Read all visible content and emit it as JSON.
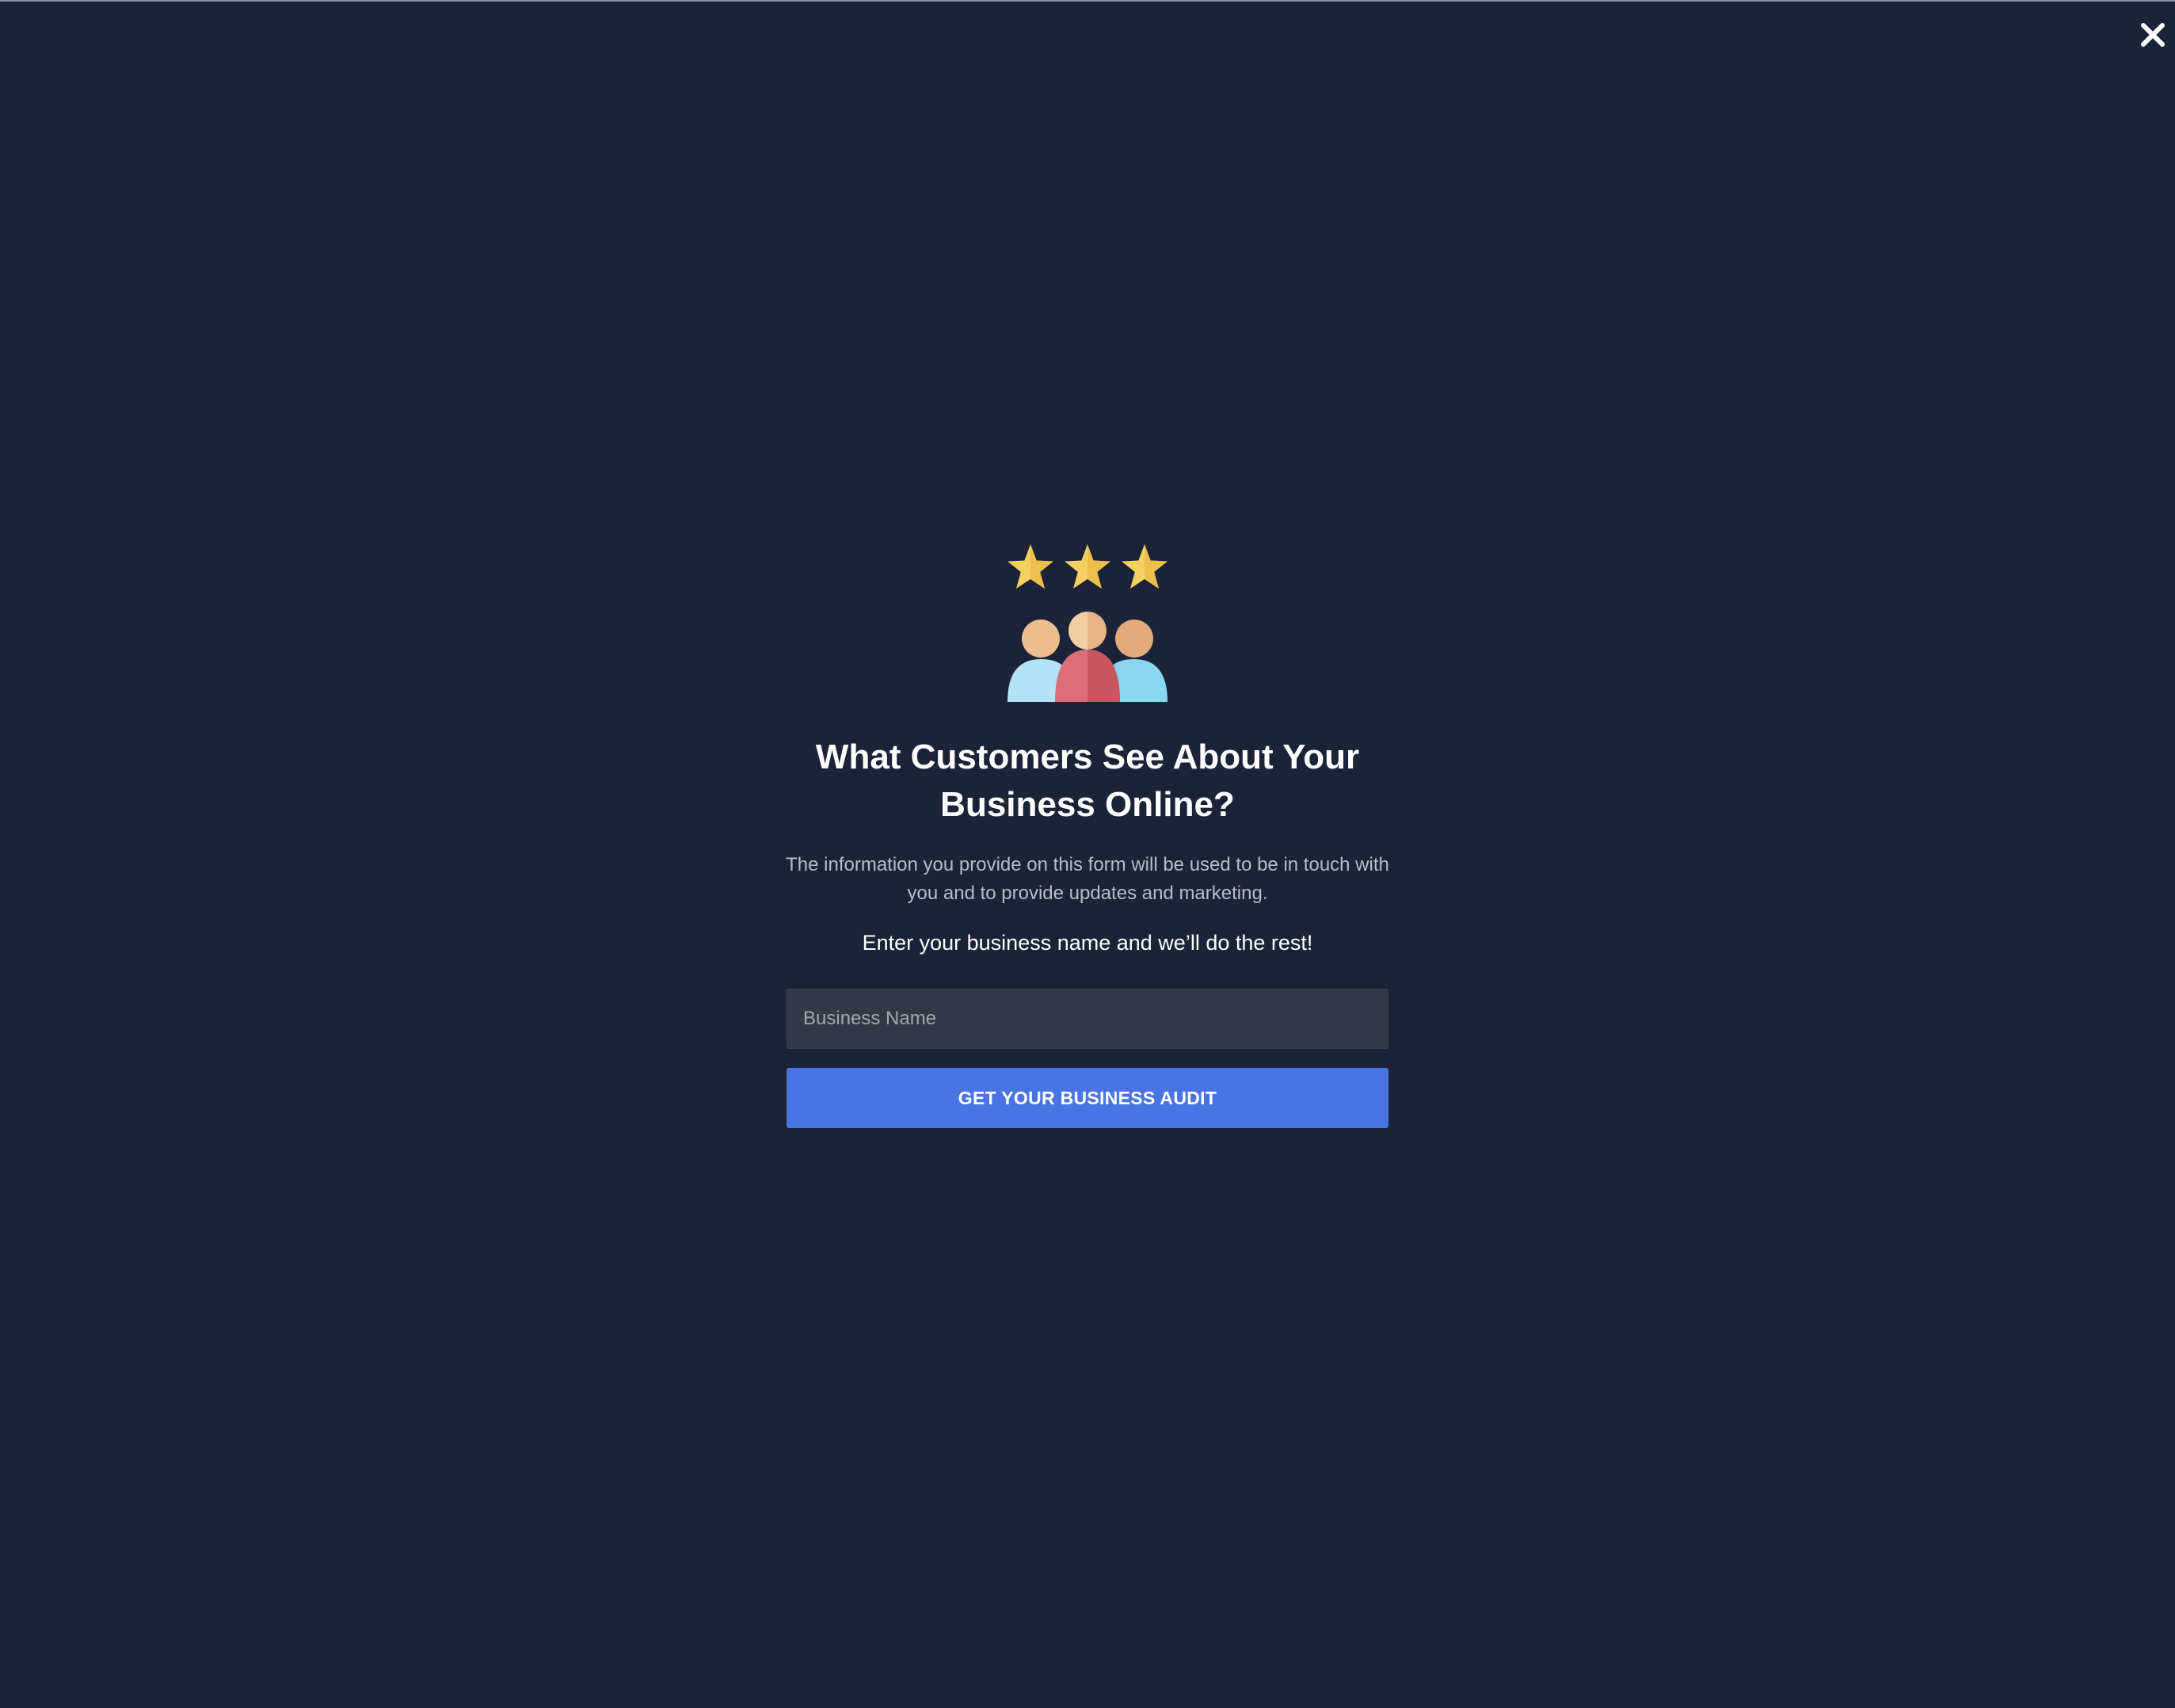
{
  "modal": {
    "title": "What Customers See About Your Business Online?",
    "disclaimer": "The information you provide on this form will be used to be in touch with you and to provide updates and marketing.",
    "tagline": "Enter your business name and we’ll do the rest!",
    "input_placeholder": "Business Name",
    "input_value": "",
    "submit_label": "GET YOUR BUSINESS AUDIT",
    "star_count": 3
  },
  "icons": {
    "close": "close-icon",
    "star": "star-icon",
    "people": "customers-group-icon"
  },
  "colors": {
    "background": "#1c2237",
    "accent": "#4a74e3",
    "star": "#f2c655",
    "input_bg": "#333849"
  }
}
